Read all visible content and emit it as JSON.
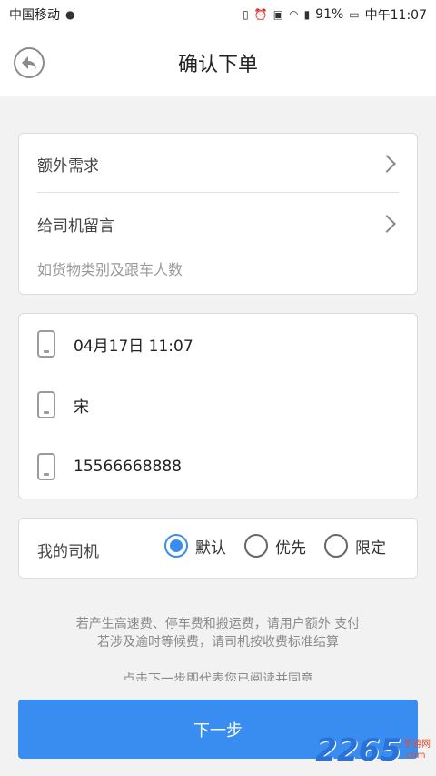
{
  "status_bar": {
    "carrier": "中国移动",
    "battery": "91%",
    "time": "中午11:07"
  },
  "header": {
    "title": "确认下单"
  },
  "options_card": {
    "extra_needs_label": "额外需求",
    "driver_message_label": "给司机留言",
    "driver_message_hint": "如货物类别及跟车人数"
  },
  "contact_card": {
    "datetime": "04月17日 11:07",
    "name": "宋",
    "phone": "15566668888"
  },
  "driver_card": {
    "label": "我的司机",
    "options": [
      {
        "label": "默认",
        "checked": true
      },
      {
        "label": "优先",
        "checked": false
      },
      {
        "label": "限定",
        "checked": false
      }
    ]
  },
  "notice": {
    "line1": "若产生高速费、停车费和搬运费，请用户额外 支付",
    "line2": "若涉及逾时等候费，请司机按收费标准结算",
    "line3": "点击下一步即代表您已阅读并同意"
  },
  "next_button": {
    "label": "下一步"
  },
  "watermark": {
    "number": "2265",
    "site_cn": "手游网",
    "site_en": ".com"
  },
  "colors": {
    "accent": "#3a8df0"
  }
}
